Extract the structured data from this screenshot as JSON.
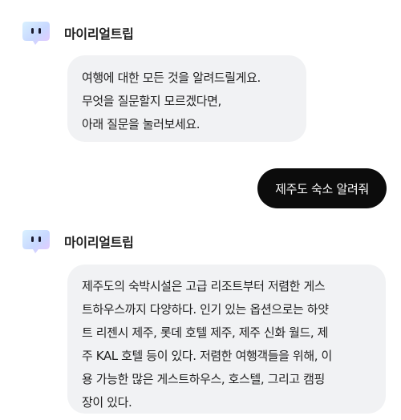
{
  "messages": [
    {
      "role": "bot",
      "sender_name": "마이리얼트립",
      "lines": [
        "여행에 대한 모든 것을 알려드릴게요.",
        "무엇을 질문할지 모르겠다면,",
        "아래 질문을 눌러보세요."
      ]
    },
    {
      "role": "user",
      "text": "제주도 숙소 알려줘"
    },
    {
      "role": "bot",
      "sender_name": "마이리얼트립",
      "lines": [
        "제주도의 숙박시설은 고급 리조트부터 저렴한 게스",
        "트하우스까지 다양하다. 인기 있는 옵션으로는 하얏",
        "트 리젠시 제주, 롯데 호텔 제주, 제주 신화 월드, 제",
        "주 KAL 호텔 등이 있다. 저렴한 여행객들을 위해, 이",
        "용 가능한 많은 게스트하우스, 호스텔, 그리고 캠핑",
        "장이 있다."
      ]
    }
  ],
  "icons": {
    "bot_avatar": "bot-avatar-icon"
  },
  "colors": {
    "bot_bubble": "#f1f2f4",
    "user_bubble": "#0c0c0c",
    "user_text": "#ffffff",
    "text": "#1f1f1f"
  }
}
